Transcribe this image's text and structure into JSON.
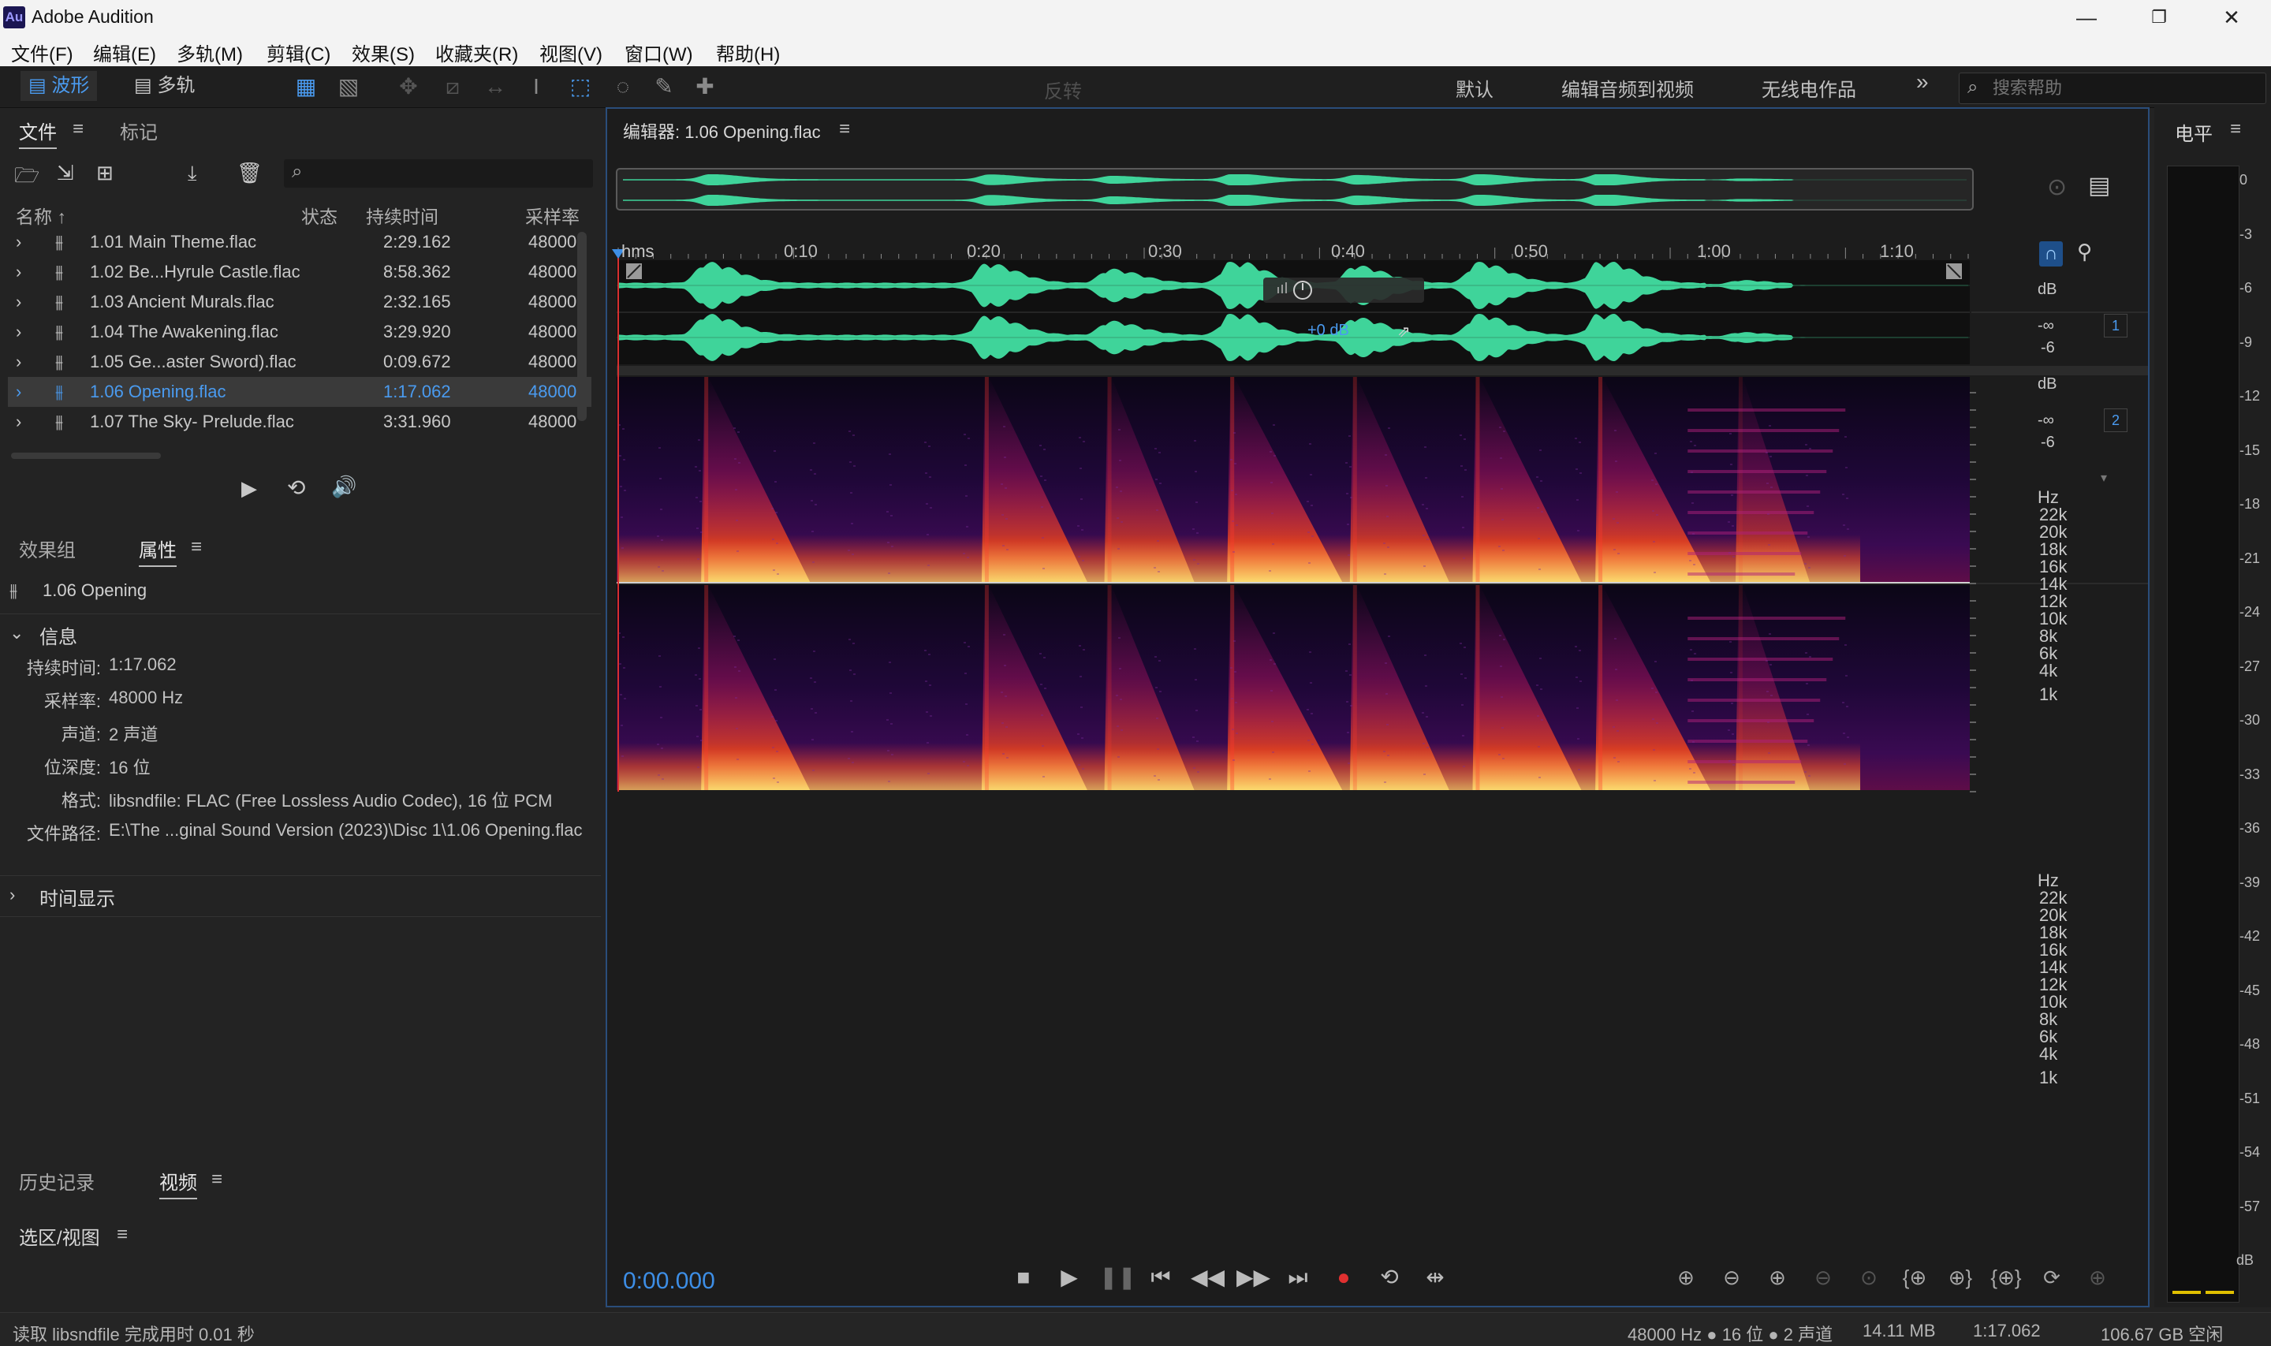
{
  "app": {
    "logo_text": "Au",
    "title": "Adobe Audition"
  },
  "window_controls": {
    "minimize": "—",
    "restore": "❐",
    "close": "✕"
  },
  "menu": [
    "文件(F)",
    "编辑(E)",
    "多轨(M)",
    "剪辑(C)",
    "效果(S)",
    "收藏夹(R)",
    "视图(V)",
    "窗口(W)",
    "帮助(H)"
  ],
  "toolbar": {
    "waveform_label": "波形",
    "multitrack_label": "多轨",
    "invert_label": "反转",
    "workspaces": [
      "默认",
      "编辑音频到视频",
      "无线电作品"
    ],
    "more": "»",
    "search_placeholder": "搜索帮助"
  },
  "files_panel": {
    "tabs": [
      "文件",
      "标记"
    ],
    "columns": {
      "name": "名称 ↑",
      "status": "状态",
      "duration": "持续时间",
      "samplerate": "采样率"
    },
    "rows": [
      {
        "name": "1.01 Main Theme.flac",
        "duration": "2:29.162",
        "rate": "48000"
      },
      {
        "name": "1.02 Be...Hyrule Castle.flac",
        "duration": "8:58.362",
        "rate": "48000"
      },
      {
        "name": "1.03 Ancient Murals.flac",
        "duration": "2:32.165",
        "rate": "48000"
      },
      {
        "name": "1.04 The Awakening.flac",
        "duration": "3:29.920",
        "rate": "48000"
      },
      {
        "name": "1.05 Ge...aster Sword).flac",
        "duration": "0:09.672",
        "rate": "48000"
      },
      {
        "name": "1.06 Opening.flac",
        "duration": "1:17.062",
        "rate": "48000",
        "selected": true
      },
      {
        "name": "1.07 The Sky- Prelude.flac",
        "duration": "3:31.960",
        "rate": "48000"
      }
    ]
  },
  "props_panel": {
    "tabs": [
      "效果组",
      "属性"
    ],
    "clip_name": "1.06 Opening",
    "info_header": "信息",
    "info": [
      {
        "label": "持续时间:",
        "value": "1:17.062"
      },
      {
        "label": "采样率:",
        "value": "48000 Hz"
      },
      {
        "label": "声道:",
        "value": "2 声道"
      },
      {
        "label": "位深度:",
        "value": "16 位"
      },
      {
        "label": "格式:",
        "value": "libsndfile: FLAC (Free Lossless Audio Codec), 16 位 PCM"
      },
      {
        "label": "文件路径:",
        "value": "E:\\The ...ginal Sound Version (2023)\\Disc 1\\1.06 Opening.flac"
      }
    ],
    "time_display_header": "时间显示"
  },
  "history_panel": {
    "tabs": [
      "历史记录",
      "视频"
    ]
  },
  "selection_panel": {
    "title": "选区/视图"
  },
  "editor": {
    "title": "编辑器: 1.06 Opening.flac",
    "ruler_unit": "hms",
    "ruler_labels": [
      "0:10",
      "0:20",
      "0:30",
      "0:40",
      "0:50",
      "1:00",
      "1:10"
    ],
    "gain_value": "+0 dB",
    "db_labels": [
      "dB",
      "-∞",
      "-6"
    ],
    "hz_labels": [
      "Hz",
      "22k",
      "20k",
      "18k",
      "16k",
      "14k",
      "12k",
      "10k",
      "8k",
      "6k",
      "4k",
      "1k"
    ],
    "channels": [
      "1",
      "2"
    ],
    "time": "0:00.000",
    "colors": {
      "waveform": "#3fd49a",
      "time": "#3d8ee6",
      "record": "#e03030",
      "selected_text": "#4a9bf0"
    }
  },
  "meter": {
    "title": "电平",
    "labels": [
      "0",
      "-3",
      "-6",
      "-9",
      "-12",
      "-15",
      "-18",
      "-21",
      "-24",
      "-27",
      "-30",
      "-33",
      "-36",
      "-39",
      "-42",
      "-45",
      "-48",
      "-51",
      "-54",
      "-57",
      "dB"
    ]
  },
  "status": {
    "left": "读取 libsndfile 完成用时 0.01 秒",
    "format": "48000 Hz ● 16 位 ● 2 声道",
    "size": "14.11 MB",
    "duration": "1:17.062",
    "free": "106.67 GB 空闲"
  }
}
